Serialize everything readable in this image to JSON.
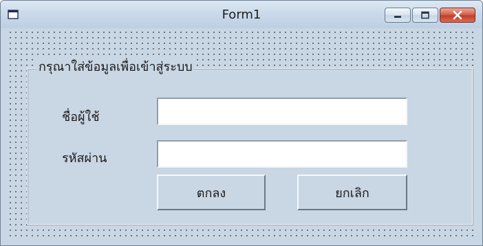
{
  "window": {
    "title": "Form1",
    "icon": "form-icon",
    "controls": [
      "minimize-icon",
      "maximize-icon",
      "close-icon"
    ]
  },
  "group": {
    "caption": "กรุณาใส่ข้อมูลเพื่อเข้าสู่ระบบ"
  },
  "fields": {
    "username_label": "ชื่อผู้ใช้",
    "username_value": "",
    "password_label": "รหัสผ่าน",
    "password_value": ""
  },
  "buttons": {
    "ok_label": "ตกลง",
    "cancel_label": "ยกเลิก"
  },
  "colors": {
    "form_background": "#c9d6e3",
    "close_button": "#c0402a"
  }
}
